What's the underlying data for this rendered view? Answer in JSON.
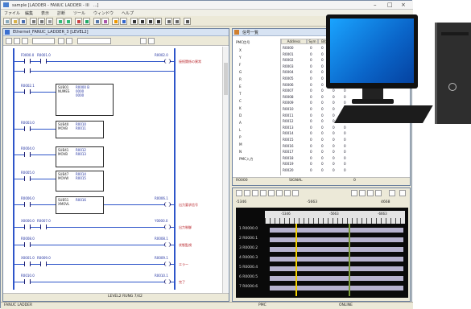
{
  "window": {
    "title": "sample [LADDER - FANUC LADDER - III　...]",
    "minimize": "–",
    "maximize": "□",
    "close": "×"
  },
  "menu": [
    "ファイル",
    "編集",
    "表示",
    "診断",
    "ツール",
    "ウィンドウ",
    "ヘルプ"
  ],
  "ladder": {
    "title": "Ethernet_FANUC_LADDER_3 [LEVEL2]",
    "combo1": "",
    "combo2": "",
    "rungs": [
      {
        "contacts": [
          "F0000.0",
          "R0001.0"
        ],
        "coil": "R0002.0",
        "comment": "接続関係の異常"
      },
      {
        "contacts": [
          "R0002.1"
        ],
        "block": {
          "code": "SUB01\nNUMES",
          "params": "R0000 B\n0000\n0000"
        }
      },
      {
        "contacts": [
          "R0003.0"
        ],
        "block": {
          "code": "SUB40\nMOVB",
          "params": "R0010\nR0011"
        }
      },
      {
        "contacts": [
          "R0004.0"
        ],
        "block": {
          "code": "SUB41\nMOVB",
          "params": "R0012\nR0013"
        }
      },
      {
        "contacts": [
          "R0005.0"
        ],
        "block": {
          "code": "SUB47\nMOVW",
          "params": "R0014\nR0015"
        }
      },
      {
        "contacts": [
          "R0006.0"
        ],
        "block": {
          "code": "SUB51\nXMOVL",
          "params": "R0016"
        },
        "coil": "R0006.1",
        "comment": "出力要求信号"
      },
      {
        "contacts": [
          "X0000.0",
          "R0007.0"
        ],
        "coil": "Y0000.0",
        "comment": "出力制御"
      },
      {
        "contacts": [
          "R0008.0"
        ],
        "coil": "R0008.1",
        "comment": "状態監視"
      },
      {
        "contacts": [
          "X0001.0",
          "R0009.0"
        ],
        "coil": "R0009.1",
        "comment": "エラー"
      },
      {
        "contacts": [
          "R0010.0"
        ],
        "coil": "R0010.1",
        "comment": "完了"
      }
    ],
    "status": "LEVEL2  RUNG 7/42"
  },
  "signals": {
    "title": "信号一覧",
    "tree": [
      "PMC信号",
      "X",
      "Y",
      "F",
      "G",
      "R",
      "E",
      "T",
      "C",
      "K",
      "D",
      "A",
      "L",
      "P",
      "M",
      "N",
      "PMC入力"
    ],
    "headers": [
      "Address",
      "Sym",
      "Bit",
      "7",
      "6"
    ],
    "rows": [
      [
        "R0000",
        "0",
        "0",
        "0",
        "0"
      ],
      [
        "R0001",
        "0",
        "0",
        "0",
        "0"
      ],
      [
        "R0002",
        "0",
        "0",
        "0",
        "0"
      ],
      [
        "R0003",
        "0",
        "0",
        "0",
        "0"
      ],
      [
        "R0004",
        "0",
        "0",
        "0",
        "0"
      ],
      [
        "R0005",
        "0",
        "0",
        "0",
        "0"
      ],
      [
        "R0006",
        "0",
        "0",
        "0",
        "0"
      ],
      [
        "R0007",
        "0",
        "0",
        "0",
        "0"
      ],
      [
        "R0008",
        "0",
        "0",
        "0",
        "0"
      ],
      [
        "R0009",
        "0",
        "0",
        "0",
        "0"
      ],
      [
        "R0010",
        "0",
        "0",
        "0",
        "0"
      ],
      [
        "R0011",
        "0",
        "0",
        "0",
        "0"
      ],
      [
        "R0012",
        "0",
        "0",
        "0",
        "0"
      ],
      [
        "R0013",
        "0",
        "0",
        "0",
        "0"
      ],
      [
        "R0014",
        "0",
        "0",
        "0",
        "0"
      ],
      [
        "R0015",
        "0",
        "0",
        "0",
        "0"
      ],
      [
        "R0016",
        "0",
        "0",
        "0",
        "0"
      ],
      [
        "R0017",
        "0",
        "0",
        "0",
        "0"
      ],
      [
        "R0018",
        "0",
        "0",
        "0",
        "0"
      ],
      [
        "R0019",
        "0",
        "0",
        "0",
        "0"
      ],
      [
        "R0020",
        "0",
        "0",
        "0",
        "0"
      ]
    ],
    "status_left": "R0000",
    "status_mid": "SIGNAL",
    "status_right": "0"
  },
  "trace": {
    "cursor1": "-5346",
    "cursor2": "-5663",
    "diff": "4668",
    "ticks": [
      "-5346",
      "-5663",
      "-6663"
    ],
    "rows": [
      "1  R0000.0",
      "2  R0000.1",
      "3  R0000.2",
      "4  R0000.3",
      "5  R0000.4",
      "6  R0000.5",
      "7  R0000.6"
    ],
    "colors": {
      "cursor_a": "#f2d000",
      "cursor_b": "#7a9a3a",
      "track": "#b7b3cf",
      "grid": "#0a0a0a"
    }
  },
  "statusbar": {
    "left": "FANUC LADDER",
    "center": "PMC",
    "right": "ONLINE"
  }
}
